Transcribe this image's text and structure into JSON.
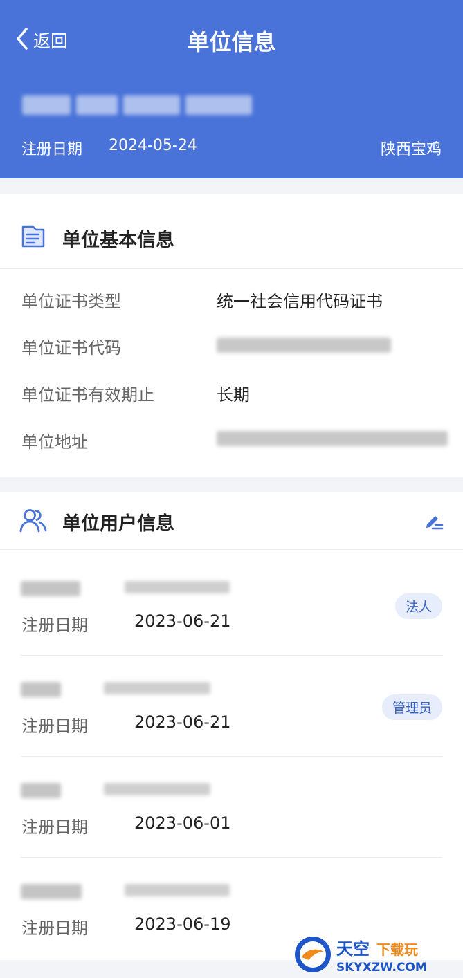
{
  "header": {
    "back_label": "返回",
    "title": "单位信息",
    "register_label": "注册日期",
    "register_date": "2024-05-24",
    "region": "陕西宝鸡",
    "accent_color": "#4a73d9"
  },
  "basic_info": {
    "title": "单位基本信息",
    "rows": [
      {
        "label": "单位证书类型",
        "value": "统一社会信用代码证书"
      },
      {
        "label": "单位证书代码",
        "value": ""
      },
      {
        "label": "单位证书有效期止",
        "value": "长期"
      },
      {
        "label": "单位地址",
        "value": ""
      }
    ]
  },
  "user_info": {
    "title": "单位用户信息",
    "users": [
      {
        "reg_label": "注册日期",
        "reg_date": "2023-06-21",
        "badge": "法人"
      },
      {
        "reg_label": "注册日期",
        "reg_date": "2023-06-21",
        "badge": "管理员"
      },
      {
        "reg_label": "注册日期",
        "reg_date": "2023-06-01",
        "badge": ""
      },
      {
        "reg_label": "注册日期",
        "reg_date": "2023-06-19",
        "badge": ""
      }
    ]
  },
  "watermark": {
    "line1": "天空下载玩",
    "line2": "SKYXZW.COM"
  },
  "icons": {
    "back": "chevron-left-icon",
    "basic_info": "document-icon",
    "user_info": "users-icon",
    "edit": "edit-icon"
  }
}
